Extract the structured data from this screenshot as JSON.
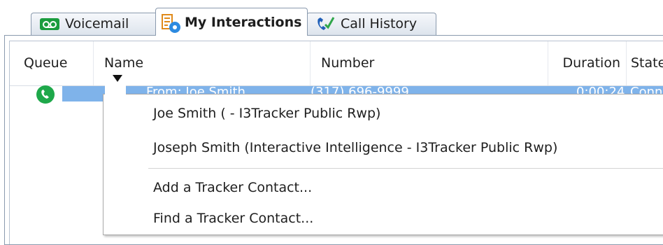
{
  "tabs": [
    {
      "label": "Voicemail",
      "icon": "voicemail-icon",
      "active": false
    },
    {
      "label": "My Interactions",
      "icon": "interactions-icon",
      "active": true
    },
    {
      "label": "Call History",
      "icon": "call-history-icon",
      "active": false
    }
  ],
  "columns": {
    "queue": "Queue",
    "name": "Name",
    "number": "Number",
    "duration": "Duration",
    "state": "State"
  },
  "row": {
    "icon": "phone-icon",
    "name": "From: Joe Smith",
    "number": "(317) 696-9999",
    "duration": "0:00:24",
    "state": "Conn"
  },
  "menu": {
    "items": [
      "Joe Smith ( - I3Tracker Public Rwp)",
      "Joseph Smith  (Interactive Intelligence - I3Tracker Public Rwp)",
      "Add a Tracker Contact...",
      "Find a Tracker Contact..."
    ]
  },
  "colors": {
    "selection": "#7fb3ea",
    "phone_green": "#1ea84a",
    "border": "#8a9aae"
  }
}
